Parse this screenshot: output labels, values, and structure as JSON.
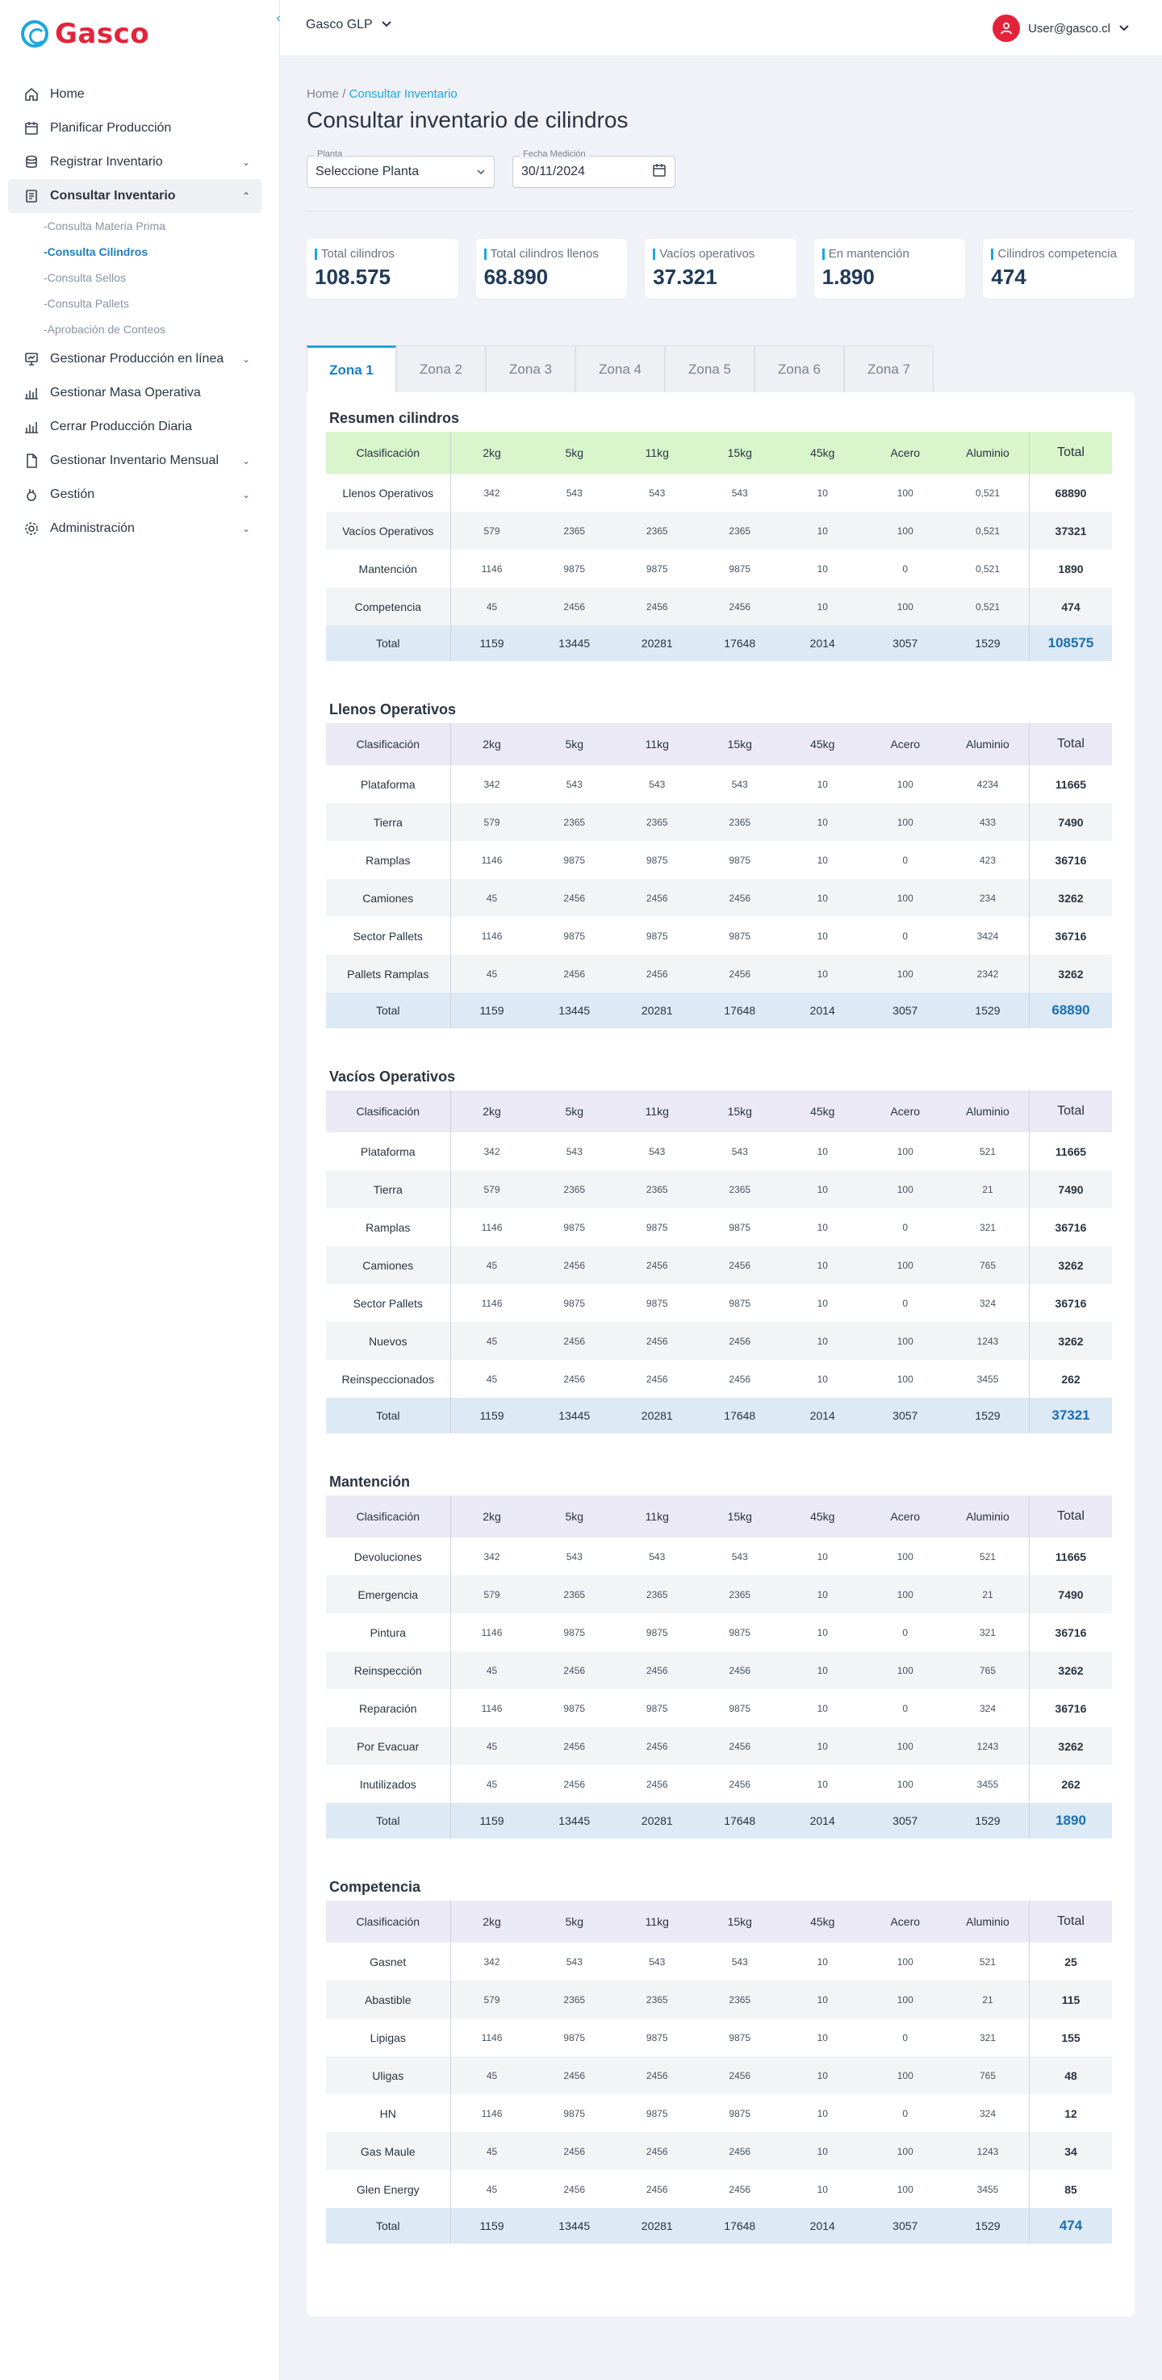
{
  "app": {
    "logo_text": "Gasco",
    "plant_selector": "Gasco GLP",
    "user_email": "User@gasco.cl"
  },
  "sidebar": {
    "items": [
      {
        "label": "Home",
        "icon": "home-icon"
      },
      {
        "label": "Planificar Producción",
        "icon": "calendar-icon"
      },
      {
        "label": "Registrar Inventario",
        "icon": "database-icon"
      },
      {
        "label": "Consultar Inventario",
        "icon": "document-icon"
      },
      {
        "label": "Gestionar Producción en línea",
        "icon": "monitor-chart-icon"
      },
      {
        "label": "Gestionar Masa Operativa",
        "icon": "bar-chart-icon"
      },
      {
        "label": "Cerrar Producción Diaria",
        "icon": "bar-chart-icon"
      },
      {
        "label": "Gestionar Inventario Mensual",
        "icon": "file-icon"
      },
      {
        "label": "Gestión",
        "icon": "hand-icon"
      },
      {
        "label": "Administración",
        "icon": "gear-icon"
      }
    ],
    "sub_items": [
      "-Consulta Materia Prima",
      "-Consulta Cilindros",
      "-Consulta Sellos",
      "-Consulta Pallets",
      "-Aprobación de Conteos"
    ]
  },
  "breadcrumb": {
    "home": "Home",
    "sep": "/",
    "current": "Consultar Inventario"
  },
  "page_title": "Consultar inventario de cilindros",
  "filters": {
    "planta_label": "Planta",
    "planta_value": "Seleccione Planta",
    "fecha_label": "Fecha Medición",
    "fecha_value": "30/11/2024"
  },
  "kpis": [
    {
      "label": "Total cilindros",
      "value": "108.575"
    },
    {
      "label": "Total cilindros llenos",
      "value": "68.890"
    },
    {
      "label": "Vacíos operativos",
      "value": "37.321"
    },
    {
      "label": "En mantención",
      "value": "1.890"
    },
    {
      "label": "Cilindros competencia",
      "value": "474"
    }
  ],
  "tabs": [
    "Zona 1",
    "Zona 2",
    "Zona 3",
    "Zona 4",
    "Zona 5",
    "Zona 6",
    "Zona 7"
  ],
  "columns": [
    "Clasificación",
    "2kg",
    "5kg",
    "11kg",
    "15kg",
    "45kg",
    "Acero",
    "Aluminio",
    "Total"
  ],
  "sections": [
    {
      "title": "Resumen cilindros",
      "rows": [
        [
          "Llenos Operativos",
          "342",
          "543",
          "543",
          "543",
          "10",
          "100",
          "0,521",
          "68890"
        ],
        [
          "Vacíos Operativos",
          "579",
          "2365",
          "2365",
          "2365",
          "10",
          "100",
          "0,521",
          "37321"
        ],
        [
          "Mantención",
          "1146",
          "9875",
          "9875",
          "9875",
          "10",
          "0",
          "0,521",
          "1890"
        ],
        [
          "Competencia",
          "45",
          "2456",
          "2456",
          "2456",
          "10",
          "100",
          "0,521",
          "474"
        ]
      ],
      "total": [
        "Total",
        "1159",
        "13445",
        "20281",
        "17648",
        "2014",
        "3057",
        "1529",
        "108575"
      ]
    },
    {
      "title": "Llenos Operativos",
      "rows": [
        [
          "Plataforma",
          "342",
          "543",
          "543",
          "543",
          "10",
          "100",
          "4234",
          "11665"
        ],
        [
          "Tierra",
          "579",
          "2365",
          "2365",
          "2365",
          "10",
          "100",
          "433",
          "7490"
        ],
        [
          "Ramplas",
          "1146",
          "9875",
          "9875",
          "9875",
          "10",
          "0",
          "423",
          "36716"
        ],
        [
          "Camiones",
          "45",
          "2456",
          "2456",
          "2456",
          "10",
          "100",
          "234",
          "3262"
        ],
        [
          "Sector Pallets",
          "1146",
          "9875",
          "9875",
          "9875",
          "10",
          "0",
          "3424",
          "36716"
        ],
        [
          "Pallets Ramplas",
          "45",
          "2456",
          "2456",
          "2456",
          "10",
          "100",
          "2342",
          "3262"
        ]
      ],
      "total": [
        "Total",
        "1159",
        "13445",
        "20281",
        "17648",
        "2014",
        "3057",
        "1529",
        "68890"
      ]
    },
    {
      "title": "Vacíos Operativos",
      "rows": [
        [
          "Plataforma",
          "342",
          "543",
          "543",
          "543",
          "10",
          "100",
          "521",
          "11665"
        ],
        [
          "Tierra",
          "579",
          "2365",
          "2365",
          "2365",
          "10",
          "100",
          "21",
          "7490"
        ],
        [
          "Ramplas",
          "1146",
          "9875",
          "9875",
          "9875",
          "10",
          "0",
          "321",
          "36716"
        ],
        [
          "Camiones",
          "45",
          "2456",
          "2456",
          "2456",
          "10",
          "100",
          "765",
          "3262"
        ],
        [
          "Sector Pallets",
          "1146",
          "9875",
          "9875",
          "9875",
          "10",
          "0",
          "324",
          "36716"
        ],
        [
          "Nuevos",
          "45",
          "2456",
          "2456",
          "2456",
          "10",
          "100",
          "1243",
          "3262"
        ],
        [
          "Reinspeccionados",
          "45",
          "2456",
          "2456",
          "2456",
          "10",
          "100",
          "3455",
          "262"
        ]
      ],
      "total": [
        "Total",
        "1159",
        "13445",
        "20281",
        "17648",
        "2014",
        "3057",
        "1529",
        "37321"
      ]
    },
    {
      "title": "Mantención",
      "rows": [
        [
          "Devoluciones",
          "342",
          "543",
          "543",
          "543",
          "10",
          "100",
          "521",
          "11665"
        ],
        [
          "Emergencia",
          "579",
          "2365",
          "2365",
          "2365",
          "10",
          "100",
          "21",
          "7490"
        ],
        [
          "Pintura",
          "1146",
          "9875",
          "9875",
          "9875",
          "10",
          "0",
          "321",
          "36716"
        ],
        [
          "Reinspección",
          "45",
          "2456",
          "2456",
          "2456",
          "10",
          "100",
          "765",
          "3262"
        ],
        [
          "Reparación",
          "1146",
          "9875",
          "9875",
          "9875",
          "10",
          "0",
          "324",
          "36716"
        ],
        [
          "Por Evacuar",
          "45",
          "2456",
          "2456",
          "2456",
          "10",
          "100",
          "1243",
          "3262"
        ],
        [
          "Inutilizados",
          "45",
          "2456",
          "2456",
          "2456",
          "10",
          "100",
          "3455",
          "262"
        ]
      ],
      "total": [
        "Total",
        "1159",
        "13445",
        "20281",
        "17648",
        "2014",
        "3057",
        "1529",
        "1890"
      ]
    },
    {
      "title": "Competencia",
      "rows": [
        [
          "Gasnet",
          "342",
          "543",
          "543",
          "543",
          "10",
          "100",
          "521",
          "25"
        ],
        [
          "Abastible",
          "579",
          "2365",
          "2365",
          "2365",
          "10",
          "100",
          "21",
          "115"
        ],
        [
          "Lipigas",
          "1146",
          "9875",
          "9875",
          "9875",
          "10",
          "0",
          "321",
          "155"
        ],
        [
          "Uligas",
          "45",
          "2456",
          "2456",
          "2456",
          "10",
          "100",
          "765",
          "48"
        ],
        [
          "HN",
          "1146",
          "9875",
          "9875",
          "9875",
          "10",
          "0",
          "324",
          "12"
        ],
        [
          "Gas Maule",
          "45",
          "2456",
          "2456",
          "2456",
          "10",
          "100",
          "1243",
          "34"
        ],
        [
          "Glen Energy",
          "45",
          "2456",
          "2456",
          "2456",
          "10",
          "100",
          "3455",
          "85"
        ]
      ],
      "total": [
        "Total",
        "1159",
        "13445",
        "20281",
        "17648",
        "2014",
        "3057",
        "1529",
        "474"
      ]
    }
  ],
  "colors": {
    "brand_red": "#e4233a",
    "accent_blue": "#1aa7df",
    "summary_header": "#d8f5cc",
    "section_header": "#ece9f6",
    "total_row": "#dde9f4"
  }
}
